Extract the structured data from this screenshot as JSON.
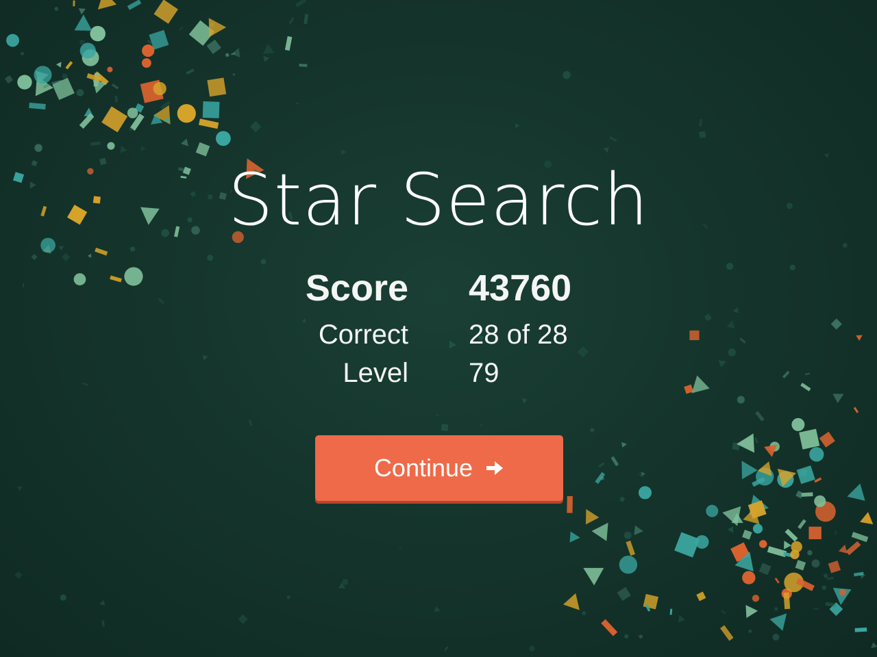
{
  "game": {
    "title": "Star Search"
  },
  "stats": {
    "score_label": "Score",
    "score_value": "43760",
    "correct_label": "Correct",
    "correct_value": "28 of 28",
    "level_label": "Level",
    "level_value": "79"
  },
  "actions": {
    "continue_label": "Continue",
    "continue_icon": "arrow-right-icon"
  },
  "colors": {
    "background": "#15352c",
    "button": "#ee6a49",
    "confetti": [
      "#3aa6a0",
      "#7fbf9a",
      "#d7a32a",
      "#d9622f",
      "#2b6b5a",
      "#5fa894"
    ]
  }
}
